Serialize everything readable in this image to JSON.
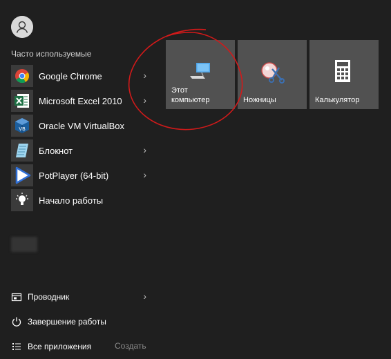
{
  "user": {
    "avatar_icon": "user-icon"
  },
  "frequent": {
    "title": "Часто используемые",
    "apps": [
      {
        "label": "Google Chrome",
        "icon": "chrome-icon",
        "has_submenu": true
      },
      {
        "label": "Microsoft Excel 2010",
        "icon": "excel-icon",
        "has_submenu": true
      },
      {
        "label": "Oracle VM VirtualBox",
        "icon": "virtualbox-icon",
        "has_submenu": false
      },
      {
        "label": "Блокнот",
        "icon": "notepad-icon",
        "has_submenu": true
      },
      {
        "label": "PotPlayer (64-bit)",
        "icon": "potplayer-icon",
        "has_submenu": true
      },
      {
        "label": "Начало работы",
        "icon": "lightbulb-icon",
        "has_submenu": false
      }
    ]
  },
  "bottom": {
    "explorer": {
      "label": "Проводник",
      "icon": "file-explorer-icon"
    },
    "shutdown": {
      "label": "Завершение работы",
      "icon": "power-icon"
    },
    "all_apps": {
      "label": "Все приложения",
      "icon": "list-icon"
    },
    "create": "Создать"
  },
  "tiles": [
    {
      "label_line1": "Этот",
      "label_line2": "компьютер",
      "icon": "computer-icon"
    },
    {
      "label_line1": "Ножницы",
      "label_line2": "",
      "icon": "scissors-icon"
    },
    {
      "label_line1": "Калькулятор",
      "label_line2": "",
      "icon": "calculator-icon"
    }
  ],
  "colors": {
    "background": "#1f1f1f",
    "tile": "#515151",
    "annotation_circle": "#d11a1a"
  }
}
